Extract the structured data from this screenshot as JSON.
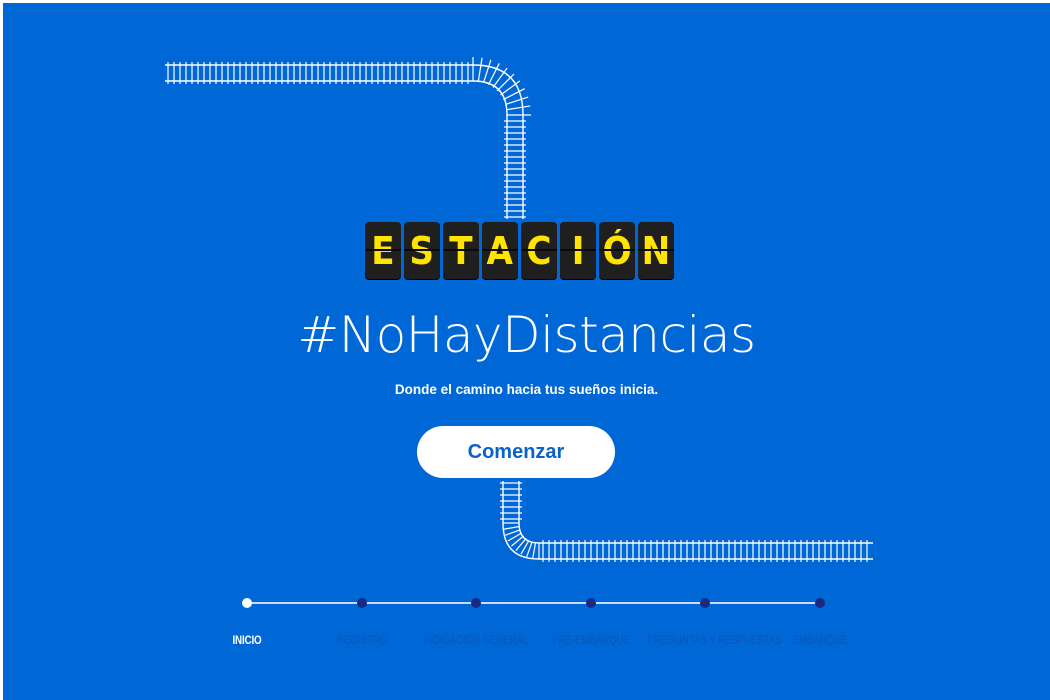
{
  "brand": {
    "letters": [
      "E",
      "S",
      "T",
      "A",
      "C",
      "I",
      "Ó",
      "N"
    ],
    "hashtag": "#NoHayDistancias",
    "tagline": "Donde el camino hacia tus sueños inicia."
  },
  "cta": {
    "label": "Comenzar"
  },
  "steps": [
    {
      "label": "INICIO",
      "active": true
    },
    {
      "label": "REGISTRO",
      "active": false
    },
    {
      "label": "INDICACIÓN GENERAL",
      "active": false
    },
    {
      "label": "PRE-EMBARQUE",
      "active": false
    },
    {
      "label": "PREGUNTAS Y RESPUESTAS",
      "active": false
    },
    {
      "label": "EMBARQUE",
      "active": false
    }
  ],
  "colors": {
    "background": "#0068d6",
    "flap_text": "#ffe400",
    "flap_tile": "#1f1f1f",
    "button_text": "#0a62c9",
    "dot_inactive": "#1a2a80",
    "label_inactive": "#0a56b8"
  }
}
